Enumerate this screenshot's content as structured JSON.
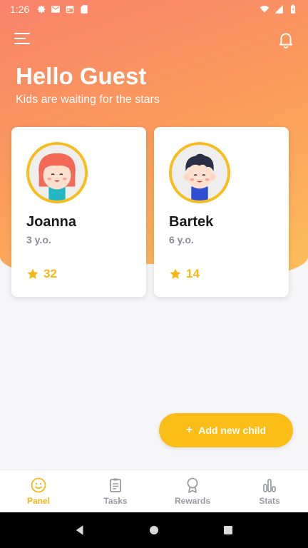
{
  "status_bar": {
    "time": "1:26",
    "left_icons": [
      "gear-icon",
      "gmail-icon",
      "calendar-icon",
      "sd-card-icon"
    ],
    "right_icons": [
      "wifi-icon",
      "signal-icon",
      "battery-icon"
    ]
  },
  "header": {
    "greeting": "Hello Guest",
    "subtitle": "Kids are waiting for the stars"
  },
  "children": [
    {
      "name": "Joanna",
      "age": "3 y.o.",
      "stars": "32"
    },
    {
      "name": "Bartek",
      "age": "6 y.o.",
      "stars": "14"
    }
  ],
  "add_child": {
    "plus": "+",
    "label": "Add new child"
  },
  "bottom_nav": {
    "items": [
      {
        "label": "Panel",
        "icon": "smiley-icon",
        "active": true
      },
      {
        "label": "Tasks",
        "icon": "clipboard-icon",
        "active": false
      },
      {
        "label": "Rewards",
        "icon": "medal-icon",
        "active": false
      },
      {
        "label": "Stats",
        "icon": "bars-icon",
        "active": false
      }
    ]
  },
  "colors": {
    "accent": "#fbbd17",
    "header_gradient_start": "#f9826a",
    "header_gradient_end": "#fdc05a",
    "star": "#f5b814"
  }
}
